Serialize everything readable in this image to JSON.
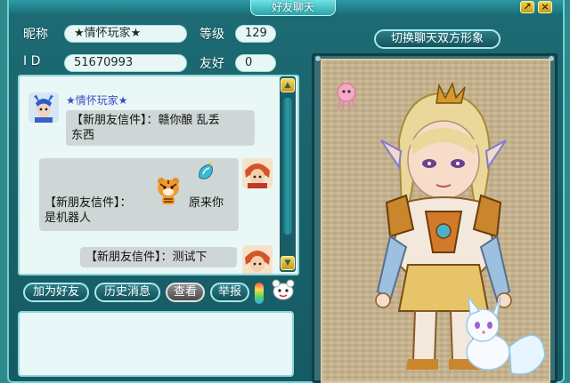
{
  "window": {
    "title": "好友聊天",
    "pin_icon": "↗",
    "close_icon": "×"
  },
  "profile": {
    "nickname_label": "昵称",
    "nickname_value": "★情怀玩家★",
    "level_label": "等级",
    "level_value": "129",
    "id_label": "I D",
    "id_value": "51670993",
    "friendship_label": "友好",
    "friendship_value": "0"
  },
  "swap_button_label": "切换聊天双方形象",
  "chat": {
    "sender_name": "★情怀玩家★",
    "messages": [
      {
        "text_line1": "【新朋友信件】：赣你酿 乱丢",
        "text_line2": "东西",
        "side": "left"
      },
      {
        "text_line1": "【新朋友信件】：",
        "text_suffix": "原来你",
        "text_line2": "是机器人",
        "side": "right"
      },
      {
        "text_line1": "【新朋友信件】：测试下",
        "side": "right"
      }
    ]
  },
  "buttons": {
    "add_friend": "加为好友",
    "history": "历史消息",
    "view": "查看",
    "report": "举报"
  },
  "colors": {
    "panel_teal": "#1d6b74",
    "accent_gold": "#f2d34a",
    "name_blue": "#3c4fc4"
  }
}
